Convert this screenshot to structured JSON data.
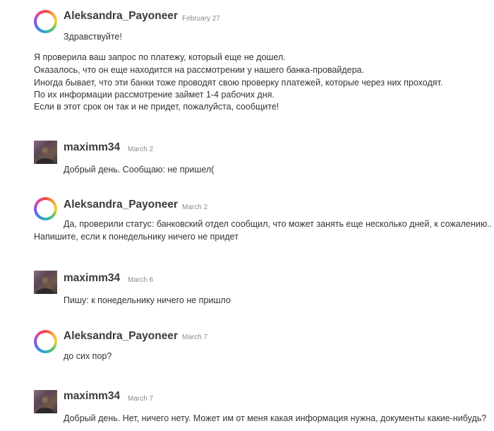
{
  "messages": [
    {
      "author": "Aleksandra_Payoneer",
      "date": "February 27",
      "avatar": "payoneer-ring-avatar",
      "greeting": "Здравствуйте!",
      "lines": [
        "Я проверила ваш запрос по платежу, который еще не дошел.",
        "Оказалось, что он еще находится на рассмотрении у нашего банка-провайдера.",
        "Иногда бывает, что эти банки тоже проводят свою проверку платежей, которые через них проходят.",
        "По их информации рассмотрение займет 1-4 рабочих дня.",
        "Если в этот срок он так и не придет, пожалуйста, сообщите!"
      ]
    },
    {
      "author": "maximm34",
      "date": "March 2",
      "avatar": "user-photo-avatar",
      "lines": [
        "Добрый день. Сообщаю: не пришел("
      ]
    },
    {
      "author": "Aleksandra_Payoneer",
      "date": "March 2",
      "avatar": "payoneer-ring-avatar",
      "lines": [
        "Да, проверили статус: банковский отдел сообщил, что может занять еще несколько дней, к сожалению..",
        "Напишите, если к понедельнику ничего не придет"
      ]
    },
    {
      "author": "maximm34",
      "date": "March 6",
      "avatar": "user-photo-avatar",
      "lines": [
        "Пишу: к понедельнику ничего не пришло"
      ]
    },
    {
      "author": "Aleksandra_Payoneer",
      "date": "March 7",
      "avatar": "payoneer-ring-avatar",
      "lines": [
        "до сих пор?"
      ]
    },
    {
      "author": "maximm34",
      "date": "March 7",
      "avatar": "user-photo-avatar",
      "lines": [
        "Добрый день. Нет, ничего нету. Может им от меня какая информация нужна, документы какие-нибудь?"
      ]
    }
  ]
}
